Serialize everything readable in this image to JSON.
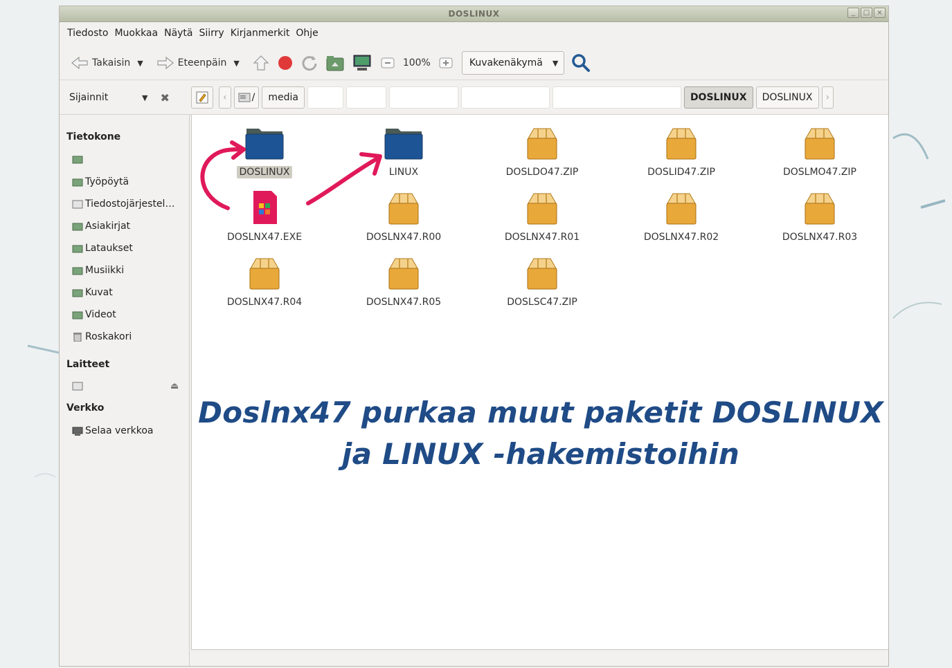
{
  "window": {
    "title": "DOSLINUX"
  },
  "menu": [
    "Tiedosto",
    "Muokkaa",
    "Näytä",
    "Siirry",
    "Kirjanmerkit",
    "Ohje"
  ],
  "toolbar": {
    "back": "Takaisin",
    "forward": "Eteenpäin",
    "zoom": "100%",
    "view": "Kuvakenäkymä"
  },
  "location": {
    "places_label": "Sijainnit",
    "media": "media",
    "active": "DOSLINUX",
    "next": "DOSLINUX"
  },
  "sidebar": {
    "computer_heading": "Tietokone",
    "items": [
      "Työpöytä",
      "Tiedostojärjestel…",
      "Asiakirjat",
      "Lataukset",
      "Musiikki",
      "Kuvat",
      "Videot",
      "Roskakori"
    ],
    "devices_heading": "Laitteet",
    "network_heading": "Verkko",
    "network_item": "Selaa verkkoa"
  },
  "files": [
    {
      "name": "DOSLINUX",
      "type": "folder"
    },
    {
      "name": "LINUX",
      "type": "folder"
    },
    {
      "name": "DOSLDO47.ZIP",
      "type": "archive"
    },
    {
      "name": "DOSLID47.ZIP",
      "type": "archive"
    },
    {
      "name": "DOSLMO47.ZIP",
      "type": "archive"
    },
    {
      "name": "DOSLNX47.EXE",
      "type": "exe"
    },
    {
      "name": "DOSLNX47.R00",
      "type": "archive"
    },
    {
      "name": "DOSLNX47.R01",
      "type": "archive"
    },
    {
      "name": "DOSLNX47.R02",
      "type": "archive"
    },
    {
      "name": "DOSLNX47.R03",
      "type": "archive"
    },
    {
      "name": "DOSLNX47.R04",
      "type": "archive"
    },
    {
      "name": "DOSLNX47.R05",
      "type": "archive"
    },
    {
      "name": "DOSLSC47.ZIP",
      "type": "archive"
    }
  ],
  "caption": {
    "line1": "Doslnx47 purkaa muut paketit DOSLINUX",
    "line2": "ja LINUX -hakemistoihin"
  },
  "colors": {
    "caption": "#1f4b86",
    "annotation_arrow": "#e0195a",
    "folder": "#1d5495",
    "archive": "#e8a93a"
  }
}
